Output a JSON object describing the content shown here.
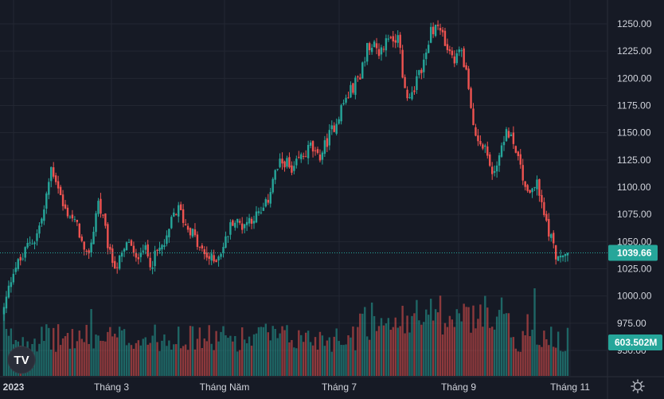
{
  "chart_data": {
    "type": "candlestick",
    "colors": {
      "up": "#26a69a",
      "down": "#ef5350",
      "background": "#161a25",
      "grid": "#232732",
      "axis_text": "#d1d4dc"
    },
    "y_axis": {
      "ticks": [
        "1250.00",
        "1225.00",
        "1200.00",
        "1175.00",
        "1150.00",
        "1125.00",
        "1100.00",
        "1075.00",
        "1050.00",
        "1025.00",
        "1000.00",
        "975.00",
        "950.00"
      ],
      "range": [
        940,
        1262
      ]
    },
    "x_axis": {
      "tick_labels": [
        "2023",
        "Tháng 3",
        "Tháng Năm",
        "Tháng 7",
        "Tháng 9",
        "Tháng 11"
      ]
    },
    "last_price": {
      "label": "1039.66",
      "value": 1039.66,
      "color": "#26a69a"
    },
    "volume_badge": {
      "label": "603.502M",
      "color": "#26a69a"
    },
    "close_path": [
      [
        0,
        988
      ],
      [
        3,
        1025
      ],
      [
        6,
        1035
      ],
      [
        8,
        1050
      ],
      [
        10,
        1052
      ],
      [
        13,
        1080
      ],
      [
        15,
        1118
      ],
      [
        17,
        1105
      ],
      [
        19,
        1080
      ],
      [
        21,
        1075
      ],
      [
        24,
        1060
      ],
      [
        26,
        1032
      ],
      [
        28,
        1050
      ],
      [
        30,
        1088
      ],
      [
        32,
        1065
      ],
      [
        34,
        1035
      ],
      [
        36,
        1028
      ],
      [
        38,
        1038
      ],
      [
        40,
        1052
      ],
      [
        42,
        1030
      ],
      [
        44,
        1048
      ],
      [
        47,
        1030
      ],
      [
        49,
        1040
      ],
      [
        52,
        1050
      ],
      [
        54,
        1075
      ],
      [
        56,
        1080
      ],
      [
        58,
        1065
      ],
      [
        60,
        1060
      ],
      [
        62,
        1045
      ],
      [
        64,
        1038
      ],
      [
        67,
        1032
      ],
      [
        70,
        1045
      ],
      [
        73,
        1070
      ],
      [
        76,
        1065
      ],
      [
        79,
        1072
      ],
      [
        82,
        1075
      ],
      [
        84,
        1085
      ],
      [
        86,
        1110
      ],
      [
        88,
        1120
      ],
      [
        90,
        1125
      ],
      [
        92,
        1110
      ],
      [
        94,
        1125
      ],
      [
        96,
        1130
      ],
      [
        98,
        1138
      ],
      [
        100,
        1125
      ],
      [
        102,
        1135
      ],
      [
        104,
        1148
      ],
      [
        106,
        1160
      ],
      [
        108,
        1175
      ],
      [
        110,
        1185
      ],
      [
        112,
        1195
      ],
      [
        114,
        1205
      ],
      [
        116,
        1228
      ],
      [
        118,
        1235
      ],
      [
        120,
        1225
      ],
      [
        122,
        1232
      ],
      [
        124,
        1236
      ],
      [
        126,
        1238
      ],
      [
        128,
        1186
      ],
      [
        130,
        1185
      ],
      [
        132,
        1200
      ],
      [
        134,
        1215
      ],
      [
        136,
        1240
      ],
      [
        138,
        1250
      ],
      [
        140,
        1238
      ],
      [
        142,
        1222
      ],
      [
        144,
        1215
      ],
      [
        146,
        1230
      ],
      [
        148,
        1198
      ],
      [
        150,
        1150
      ],
      [
        152,
        1145
      ],
      [
        154,
        1135
      ],
      [
        156,
        1108
      ],
      [
        158,
        1130
      ],
      [
        160,
        1150
      ],
      [
        162,
        1148
      ],
      [
        164,
        1132
      ],
      [
        166,
        1105
      ],
      [
        168,
        1095
      ],
      [
        170,
        1105
      ],
      [
        172,
        1080
      ],
      [
        174,
        1060
      ],
      [
        176,
        1040
      ],
      [
        178,
        1032
      ],
      [
        180,
        1039.66
      ]
    ]
  }
}
